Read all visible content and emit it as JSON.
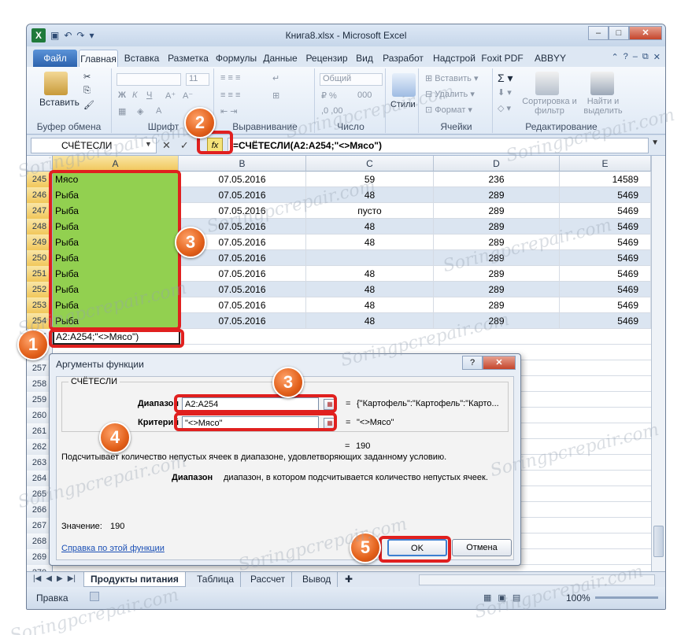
{
  "window": {
    "title": "Книга8.xlsx - Microsoft Excel",
    "minimize": "–",
    "maximize": "□",
    "close": "✕"
  },
  "ribbon_tabs": [
    "Файл",
    "Главная",
    "Вставка",
    "Разметка",
    "Формулы",
    "Данные",
    "Рецензир",
    "Вид",
    "Разработ",
    "Надстрой",
    "Foxit PDF",
    "ABBYY PDF"
  ],
  "ribbon": {
    "clipboard": {
      "paste": "Вставить",
      "label": "Буфер обмена"
    },
    "font": {
      "size": "11",
      "label": "Шрифт"
    },
    "alignment": {
      "label": "Выравнивание"
    },
    "number": {
      "format": "Общий",
      "label": "Число"
    },
    "styles": {
      "styles": "Стили"
    },
    "cells": {
      "insert": "Вставить",
      "delete": "Удалить",
      "format": "Формат",
      "label": "Ячейки"
    },
    "editing": {
      "sort": "Сортировка и фильтр",
      "find": "Найти и выделить",
      "label": "Редактирование"
    }
  },
  "formula_bar": {
    "name_box": "СЧЁТЕСЛИ",
    "fx": "fx",
    "formula": "=СЧЁТЕСЛИ(A2:A254;\"<>Мясо\")"
  },
  "grid": {
    "columns": [
      "A",
      "B",
      "C",
      "D",
      "E"
    ],
    "rows": [
      {
        "num": "245",
        "a": "Мясо",
        "b": "07.05.2016",
        "c": "59",
        "d": "236",
        "e": "14589"
      },
      {
        "num": "246",
        "a": "Рыба",
        "b": "07.05.2016",
        "c": "48",
        "d": "289",
        "e": "5469"
      },
      {
        "num": "247",
        "a": "Рыба",
        "b": "07.05.2016",
        "c": "пусто",
        "d": "289",
        "e": "5469"
      },
      {
        "num": "248",
        "a": "Рыба",
        "b": "07.05.2016",
        "c": "48",
        "d": "289",
        "e": "5469"
      },
      {
        "num": "249",
        "a": "Рыба",
        "b": "07.05.2016",
        "c": "48",
        "d": "289",
        "e": "5469"
      },
      {
        "num": "250",
        "a": "Рыба",
        "b": "07.05.2016",
        "c": "",
        "d": "289",
        "e": "5469"
      },
      {
        "num": "251",
        "a": "Рыба",
        "b": "07.05.2016",
        "c": "48",
        "d": "289",
        "e": "5469"
      },
      {
        "num": "252",
        "a": "Рыба",
        "b": "07.05.2016",
        "c": "48",
        "d": "289",
        "e": "5469"
      },
      {
        "num": "253",
        "a": "Рыба",
        "b": "07.05.2016",
        "c": "48",
        "d": "289",
        "e": "5469"
      },
      {
        "num": "254",
        "a": "Рыба",
        "b": "07.05.2016",
        "c": "48",
        "d": "289",
        "e": "5469"
      }
    ],
    "edit_cell": "A2:A254;\"<>Мясо\")",
    "lower_rows": [
      "255",
      "256",
      "257",
      "258",
      "259",
      "260",
      "261",
      "262",
      "263",
      "264",
      "265",
      "266",
      "267",
      "268",
      "269",
      "270"
    ]
  },
  "dialog": {
    "title": "Аргументы функции",
    "help_btn": "?",
    "close_btn": "✕",
    "function_name": "СЧЁТЕСЛИ",
    "arg1_label": "Диапазон",
    "arg1_value": "A2:A254",
    "arg1_result": "{\"Картофель\":\"Картофель\":\"Карто...",
    "arg2_label": "Критерий",
    "arg2_value": "\"<>Мясо\"",
    "arg2_result": "\"<>Мясо\"",
    "eq": "=",
    "result": "190",
    "description": "Подсчитывает количество непустых ячеек в диапазоне, удовлетворяющих заданному условию.",
    "arg_help_label": "Диапазон",
    "arg_help_text": "диапазон, в котором подсчитывается количество непустых ячеек.",
    "value_label": "Значение:",
    "value": "190",
    "help_link": "Справка по этой функции",
    "ok": "OK",
    "cancel": "Отмена"
  },
  "sheets": [
    "Продукты питания",
    "Таблица",
    "Рассчет",
    "Вывод"
  ],
  "status": {
    "ready": "Правка",
    "zoom": "100%"
  },
  "badges": [
    "1",
    "2",
    "3",
    "3",
    "4",
    "5"
  ],
  "watermark": "Soringpcrepair.com",
  "colors": {
    "highlight": "#e0201f",
    "badge": "#e2601a",
    "selection": "#92d050",
    "band": "#dbe5f1"
  }
}
